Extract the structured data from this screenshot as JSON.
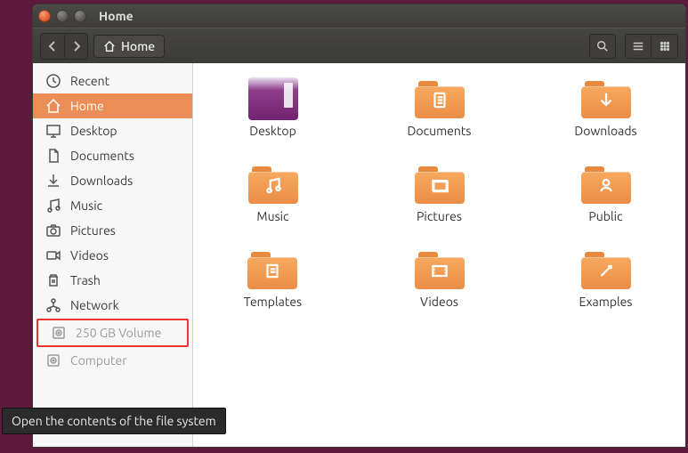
{
  "window": {
    "title": "Home"
  },
  "toolbar": {
    "breadcrumb_label": "Home"
  },
  "sidebar": {
    "items": [
      {
        "label": "Recent",
        "icon": "clock"
      },
      {
        "label": "Home",
        "icon": "home"
      },
      {
        "label": "Desktop",
        "icon": "desktop"
      },
      {
        "label": "Documents",
        "icon": "document"
      },
      {
        "label": "Downloads",
        "icon": "download"
      },
      {
        "label": "Music",
        "icon": "music"
      },
      {
        "label": "Pictures",
        "icon": "camera"
      },
      {
        "label": "Videos",
        "icon": "video"
      },
      {
        "label": "Trash",
        "icon": "trash"
      },
      {
        "label": "Network",
        "icon": "network"
      },
      {
        "label": "250 GB Volume",
        "icon": "disk"
      },
      {
        "label": "Computer",
        "icon": "disk"
      }
    ],
    "active_index": 1,
    "highlighted_index": 10,
    "dim_indices": [
      10,
      11
    ]
  },
  "files": [
    {
      "label": "Desktop",
      "kind": "desktop"
    },
    {
      "label": "Documents",
      "kind": "document"
    },
    {
      "label": "Downloads",
      "kind": "download"
    },
    {
      "label": "Music",
      "kind": "music"
    },
    {
      "label": "Pictures",
      "kind": "picture"
    },
    {
      "label": "Public",
      "kind": "public"
    },
    {
      "label": "Templates",
      "kind": "template"
    },
    {
      "label": "Videos",
      "kind": "video"
    },
    {
      "label": "Examples",
      "kind": "examples"
    }
  ],
  "tooltip": "Open the contents of the file system"
}
